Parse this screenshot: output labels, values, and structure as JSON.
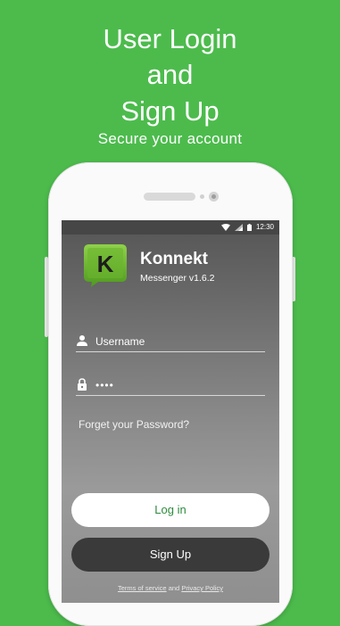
{
  "promo": {
    "line1": "User Login",
    "line2": "and",
    "line3": "Sign Up",
    "subtitle": "Secure your account"
  },
  "status_bar": {
    "time": "12:30",
    "icons": [
      "wifi-icon",
      "signal-icon",
      "battery-icon"
    ]
  },
  "app": {
    "name": "Konnekt",
    "version": "Messenger v1.6.2",
    "logo_letter": "K",
    "brand_color": "#6ab42e"
  },
  "form": {
    "username_placeholder": "Username",
    "password_value": "••••",
    "forgot_link": "Forget your Password?",
    "login_label": "Log in",
    "signup_label": "Sign Up"
  },
  "footer": {
    "terms_link": "Terms of service",
    "and_text": "and",
    "privacy_link": "Privacy Policy"
  },
  "colors": {
    "background": "#4cbb4c",
    "login_text": "#2e8b3e",
    "signup_bg": "#3a3a3a"
  }
}
